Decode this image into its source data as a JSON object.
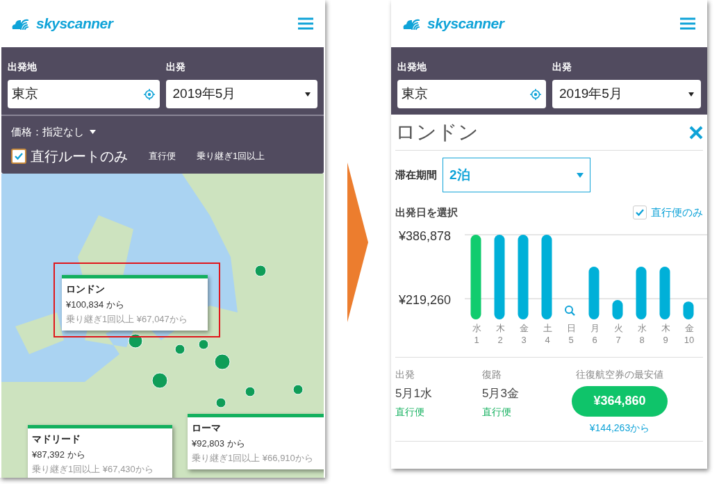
{
  "left_screen": {
    "logo": "skyscanner",
    "search": {
      "origin_label": "出発地",
      "origin_value": "東京",
      "date_label": "出発",
      "date_value": "2019年5月"
    },
    "price_filter": "価格：指定なし",
    "direct_only": {
      "label": "直行ルートのみ",
      "checked": true
    },
    "legend": [
      "直行便",
      "乗り継ぎ1回以上"
    ],
    "map_popups": [
      {
        "city": "ロンドン",
        "price": "¥100,834 から",
        "transfer_price": "乗り継ぎ1回以上 ¥67,047から",
        "highlighted": true
      },
      {
        "city": "ローマ",
        "price": "¥92,803 から",
        "transfer_price": "乗り継ぎ1回以上 ¥66,910から",
        "highlighted": false
      },
      {
        "city": "マドリード",
        "price": "¥87,392 から",
        "transfer_price": "乗り継ぎ1回以上 ¥67,430から",
        "highlighted": false
      }
    ]
  },
  "right_screen": {
    "logo": "skyscanner",
    "search": {
      "origin_label": "出発地",
      "origin_value": "東京",
      "date_label": "出発",
      "date_value": "2019年5月"
    },
    "title": "ロンドン",
    "stay": {
      "label": "滞在期間",
      "value": "2泊"
    },
    "date_section": {
      "title": "出発日を選択",
      "direct_only": {
        "label": "直行便のみ",
        "checked": true
      }
    },
    "chart_data": {
      "type": "bar",
      "categories": [
        "水 1",
        "木 2",
        "金 3",
        "土 4",
        "日 5",
        "月 6",
        "火 7",
        "水 8",
        "木 9",
        "金 10"
      ],
      "yticks": [
        {
          "value": 219260,
          "label": "¥219,260"
        },
        {
          "value": 386878,
          "label": "¥386,878"
        }
      ],
      "ylim": [
        165000,
        386878
      ],
      "values": [
        386878,
        386878,
        386878,
        386878,
        null,
        303000,
        216000,
        303000,
        303000,
        212000
      ]
    },
    "days": [
      {
        "selected": true
      },
      {
        "selected": false
      },
      {
        "selected": false
      },
      {
        "selected": false
      },
      {
        "selected": false
      },
      {
        "selected": false
      },
      {
        "selected": false
      },
      {
        "selected": false
      },
      {
        "selected": false
      },
      {
        "selected": false
      }
    ],
    "summary": [
      {
        "label": "出発",
        "date": "5月1水",
        "note": "直行便"
      },
      {
        "label": "復路",
        "date": "5月3金",
        "note": "直行便"
      }
    ],
    "best": {
      "label": "往復航空券の最安値",
      "price": "¥364,860",
      "from": "¥144,263から"
    }
  }
}
